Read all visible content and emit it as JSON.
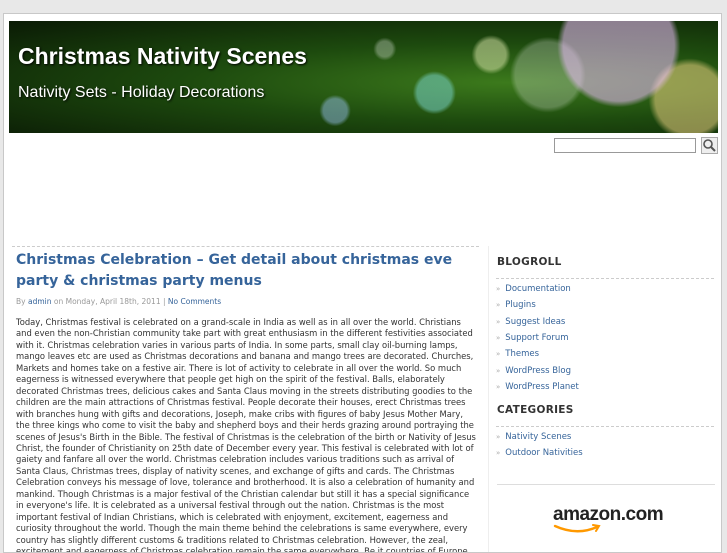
{
  "header": {
    "title": "Christmas Nativity Scenes",
    "description": "Nativity Sets - Holiday Decorations"
  },
  "search": {
    "value": ""
  },
  "post": {
    "title": "Christmas Celebration – Get detail about christmas eve party & christmas party menus",
    "meta_by": "By",
    "meta_author": "admin",
    "meta_on": "on Monday, April 18th, 2011 |",
    "meta_comments": "No Comments",
    "body": "Today, Christmas festival is celebrated on a grand-scale in India as well as in all over the world. Christians and even the non-Christian community take part with great enthusiasm in the different festivities associated with it. Christmas celebration varies in various parts of India. In some parts, small clay oil-burning lamps, mango leaves etc are used as Christmas decorations and banana and mango trees are decorated. Churches, Markets and homes take on a festive air. There is lot of activity to celebrate in all over the world. So much eagerness is witnessed everywhere that people get high on the spirit of the festival. Balls, elaborately decorated Christmas trees, delicious cakes and Santa Claus moving in the streets distributing goodies to the children are the main attractions of Christmas festival. People decorate their houses, erect Christmas trees with branches hung with gifts and decorations, Joseph, make cribs with figures of baby Jesus Mother Mary, the three kings who come to visit the baby and shepherd boys and their herds grazing around portraying the scenes of Jesus's Birth in the Bible. The festival of Christmas is the celebration of the birth or Nativity of Jesus Christ, the founder of Christianity on 25th date of December every year. This festival is celebrated with lot of gaiety and fanfare all over the world. Christmas celebration includes various traditions such as arrival of Santa Claus, Christmas trees, display of nativity scenes, and exchange of gifts and cards. The Christmas Celebration conveys his message of love, tolerance and brotherhood. It is also a celebration of humanity and mankind. Though Christmas is a major festival of the Christian calendar but still it has a special significance in everyone's life. It is celebrated as a universal festival through out the nation. Christmas is the most important festival of Indian Christians, which is celebrated with enjoyment, excitement, eagerness and curiosity throughout the world. Though the main theme behind the celebrations is same everywhere, every country has slightly different customs & traditions related to Christmas celebration. However, the zeal, excitement and eagerness of Christmas celebration remain the same everywhere. Be it countries of Europe or"
  },
  "sidebar": {
    "blogroll_title": "BLOGROLL",
    "blogroll": [
      "Documentation",
      "Plugins",
      "Suggest Ideas",
      "Support Forum",
      "Themes",
      "WordPress Blog",
      "WordPress Planet"
    ],
    "categories_title": "CATEGORIES",
    "categories": [
      "Nativity Scenes",
      "Outdoor Nativities"
    ],
    "ad_logo": "amazon.com"
  },
  "colors": {
    "link": "#36649a",
    "text": "#333333",
    "meta": "#999999"
  },
  "icons": {
    "search_button": "magnifier-icon",
    "list_bullet": "double-arrow-icon"
  }
}
